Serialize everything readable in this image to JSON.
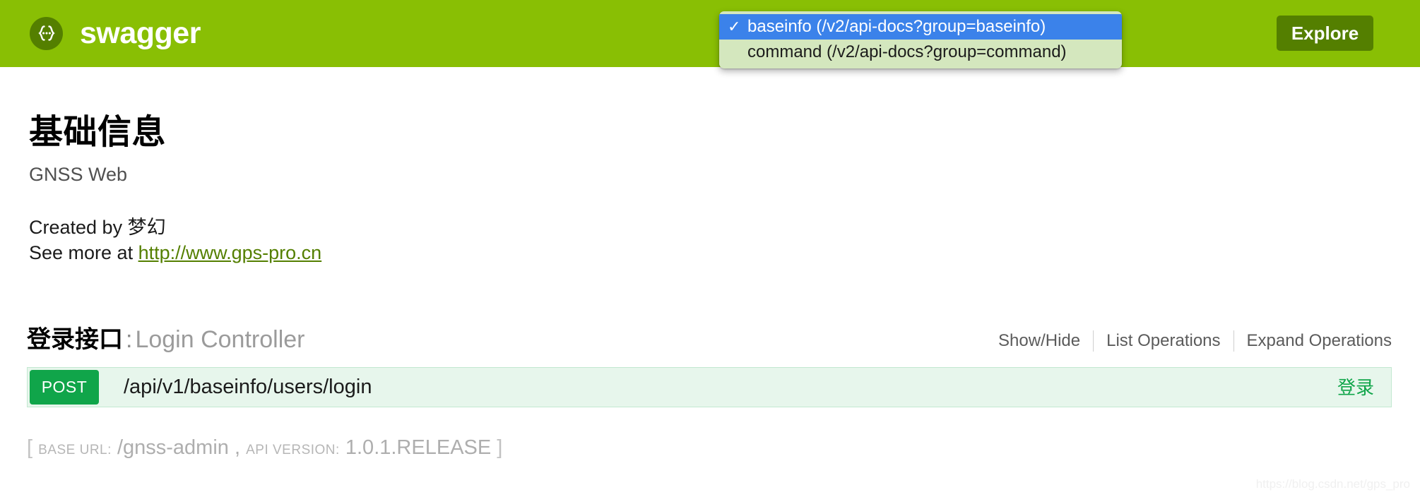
{
  "topbar": {
    "logo_text": "swagger",
    "logo_icon": "swagger-braces-icon",
    "explore_label": "Explore",
    "background_color": "#89bf04",
    "explore_color": "#547f00"
  },
  "api_selector": {
    "selected_index": 0,
    "check_glyph": "✓",
    "highlight_color": "#3b82ea",
    "panel_color": "#d4e7be",
    "options": [
      {
        "label": "baseinfo (/v2/api-docs?group=baseinfo)",
        "selected": true
      },
      {
        "label": "command (/v2/api-docs?group=command)",
        "selected": false
      }
    ]
  },
  "info": {
    "title": "基础信息",
    "subtitle": "GNSS Web",
    "created_by": "Created by 梦幻",
    "see_more_prefix": "See more at ",
    "website": "http://www.gps-pro.cn",
    "link_color": "#547f00"
  },
  "resource": {
    "name": "登录接口",
    "separator": ":",
    "description": "Login Controller",
    "options": [
      {
        "label": "Show/Hide"
      },
      {
        "label": "List Operations"
      },
      {
        "label": "Expand Operations"
      }
    ]
  },
  "operations": [
    {
      "method": "POST",
      "method_color": "#10a54a",
      "path": "/api/v1/baseinfo/users/login",
      "summary": "登录"
    }
  ],
  "footer": {
    "open_bracket": "[",
    "base_url_label": "BASE URL",
    "base_url_colon": ":",
    "base_url_value": "/gnss-admin",
    "comma": ",",
    "api_version_label": "API VERSION",
    "api_version_colon": ":",
    "api_version_value": "1.0.1.RELEASE",
    "close_bracket": "]"
  },
  "watermark": {
    "text": "https://blog.csdn.net/gps_pro"
  }
}
